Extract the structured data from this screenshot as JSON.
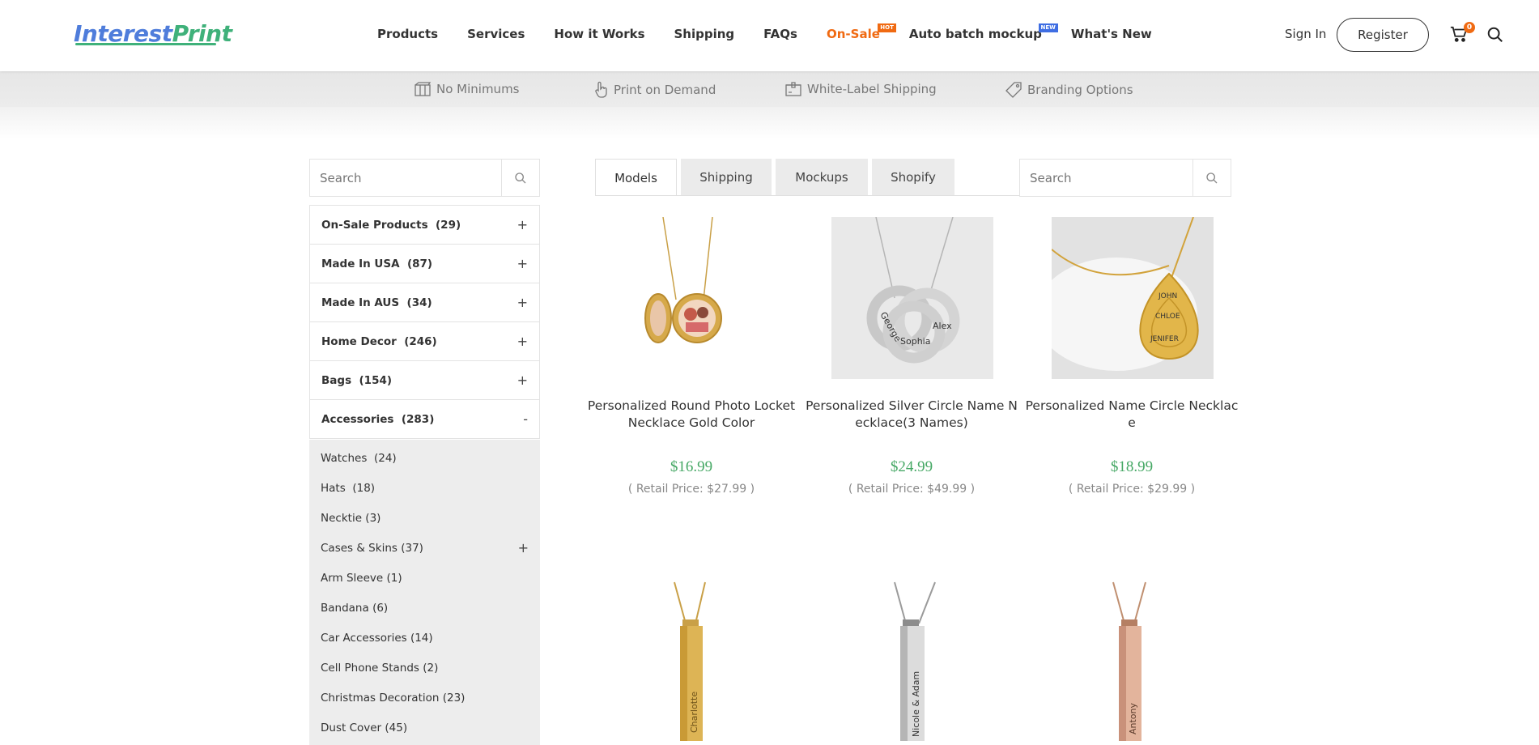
{
  "header": {
    "logo_part1": "Interest",
    "logo_part2": "Print",
    "nav": [
      {
        "label": "Products"
      },
      {
        "label": "Services"
      },
      {
        "label": "How it Works"
      },
      {
        "label": "Shipping"
      },
      {
        "label": "FAQs"
      },
      {
        "label": "On-Sale",
        "tag": "HOT"
      },
      {
        "label": "Auto batch mockup",
        "tag": "NEW"
      },
      {
        "label": "What's New"
      }
    ],
    "sign_in": "Sign In",
    "register": "Register",
    "cart_count": "0"
  },
  "features": [
    {
      "label": "No Minimums",
      "icon": "box-icon"
    },
    {
      "label": "Print on Demand",
      "icon": "hand-pointer-icon"
    },
    {
      "label": "White-Label Shipping",
      "icon": "package-icon"
    },
    {
      "label": "Branding Options",
      "icon": "tag-icon"
    }
  ],
  "sidebar": {
    "search_placeholder": "Search",
    "categories": [
      {
        "label": "On-Sale Products",
        "count": "(29)",
        "toggle": "+"
      },
      {
        "label": "Made In USA",
        "count": "(87)",
        "toggle": "+"
      },
      {
        "label": "Made In AUS",
        "count": "(34)",
        "toggle": "+"
      },
      {
        "label": "Home Decor",
        "count": "(246)",
        "toggle": "+"
      },
      {
        "label": "Bags",
        "count": "(154)",
        "toggle": "+"
      },
      {
        "label": "Accessories",
        "count": "(283)",
        "toggle": "-"
      }
    ],
    "subcategories": [
      {
        "label": "Watches",
        "count": "(24)",
        "toggle": ""
      },
      {
        "label": "Hats",
        "count": "(18)",
        "toggle": ""
      },
      {
        "label": "Necktie",
        "count": "(3)",
        "toggle": ""
      },
      {
        "label": "Cases & Skins",
        "count": "(37)",
        "toggle": "+"
      },
      {
        "label": "Arm Sleeve",
        "count": "(1)",
        "toggle": ""
      },
      {
        "label": "Bandana",
        "count": "(6)",
        "toggle": ""
      },
      {
        "label": "Car Accessories",
        "count": "(14)",
        "toggle": ""
      },
      {
        "label": "Cell Phone Stands",
        "count": "(2)",
        "toggle": ""
      },
      {
        "label": "Christmas Decoration",
        "count": "(23)",
        "toggle": ""
      },
      {
        "label": "Dust Cover",
        "count": "(45)",
        "toggle": ""
      }
    ]
  },
  "tabs": [
    {
      "label": "Models",
      "active": true
    },
    {
      "label": "Shipping",
      "active": false
    },
    {
      "label": "Mockups",
      "active": false
    },
    {
      "label": "Shopify",
      "active": false
    }
  ],
  "main_search_placeholder": "Search",
  "products": [
    {
      "name": "Personalized Round Photo Locket Necklace Gold Color",
      "price": "$16.99",
      "retail": "( Retail Price: $27.99 )",
      "image": "gold-locket"
    },
    {
      "name": "Personalized Silver Circle Name Necklace(3 Names)",
      "price": "$24.99",
      "retail": "( Retail Price: $49.99 )",
      "image": "silver-rings",
      "engraving": [
        "George",
        "Alex",
        "Sophia"
      ]
    },
    {
      "name": "Personalized Name Circle Necklace",
      "price": "$18.99",
      "retail": "( Retail Price: $29.99 )",
      "image": "gold-teardrops",
      "engraving": [
        "JOHN",
        "CHLOE",
        "JENIFER"
      ]
    },
    {
      "name": "",
      "price": "",
      "retail": "",
      "image": "gold-bar",
      "engraving": [
        "Charlotte"
      ]
    },
    {
      "name": "",
      "price": "",
      "retail": "",
      "image": "silver-bar",
      "engraving": [
        "Nicole & Adam"
      ]
    },
    {
      "name": "",
      "price": "",
      "retail": "",
      "image": "rose-bar",
      "engraving": [
        "Antony"
      ]
    }
  ],
  "colors": {
    "accent_orange": "#f06a12",
    "price_green": "#46a865",
    "logo_blue": "#4f7ddb",
    "logo_green": "#3fb17a"
  }
}
